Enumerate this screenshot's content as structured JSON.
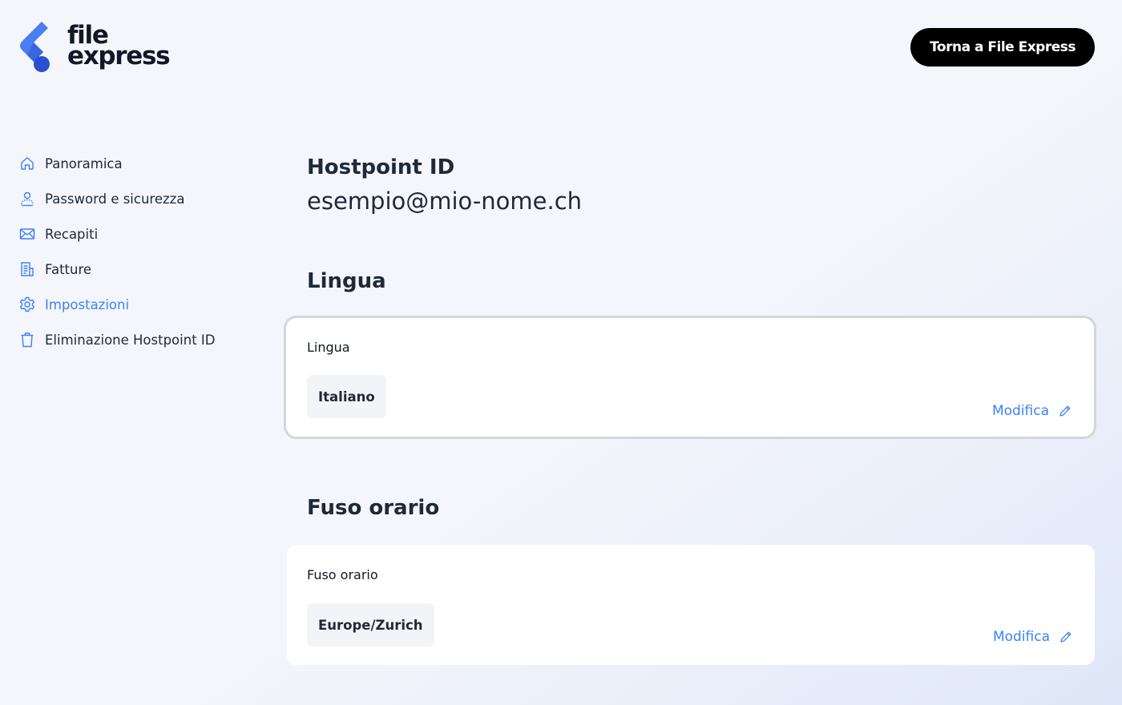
{
  "brand": {
    "name_line1": "file",
    "name_line2": "express",
    "logo_icon": "file-express-logo-icon",
    "accent_color": "#3b82f6"
  },
  "header": {
    "back_button_label": "Torna a File Express"
  },
  "sidebar": {
    "items": [
      {
        "label": "Panoramica",
        "icon": "home-icon",
        "active": false
      },
      {
        "label": "Password e sicurezza",
        "icon": "user-shield-icon",
        "active": false
      },
      {
        "label": "Recapiti",
        "icon": "envelope-icon",
        "active": false
      },
      {
        "label": "Fatture",
        "icon": "invoice-icon",
        "active": false
      },
      {
        "label": "Impostazioni",
        "icon": "gear-icon",
        "active": true
      },
      {
        "label": "Eliminazione Hostpoint ID",
        "icon": "trash-icon",
        "active": false
      }
    ]
  },
  "main": {
    "hostpoint": {
      "title": "Hostpoint ID",
      "value": "esempio@mio-nome.ch"
    },
    "language": {
      "section_title": "Lingua",
      "card_label": "Lingua",
      "value": "Italiano",
      "edit_label": "Modifica"
    },
    "timezone": {
      "section_title": "Fuso orario",
      "card_label": "Fuso orario",
      "value": "Europe/Zurich",
      "edit_label": "Modifica"
    }
  }
}
